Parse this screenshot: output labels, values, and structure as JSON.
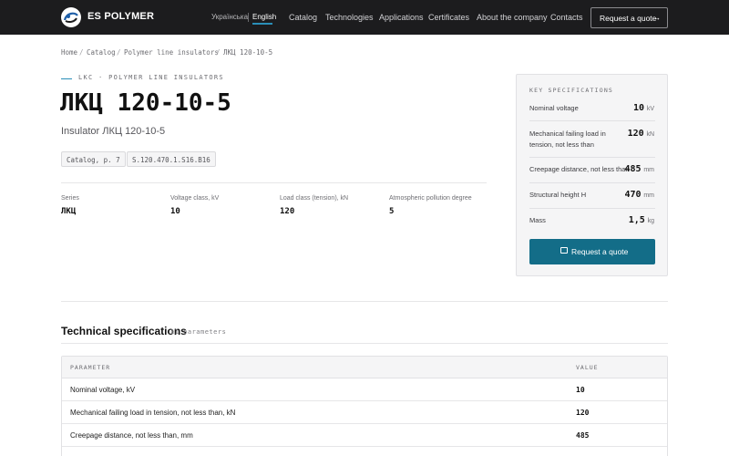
{
  "header": {
    "brand": "ES POLYMER",
    "lang_uk": "Українська",
    "lang_en": "English",
    "nav": [
      "Catalog",
      "Technologies",
      "Applications",
      "Certificates",
      "About the company",
      "Contacts"
    ],
    "quote_button": "Request a quote",
    "quote_arrow": "→"
  },
  "breadcrumb": [
    "Home",
    "Catalog",
    "Polymer line insulators",
    "ЛКЦ 120-10-5"
  ],
  "breadcrumb_sep": "/",
  "product": {
    "kicker": "LKC · POLYMER LINE INSULATORS",
    "title": "ЛКЦ 120-10-5",
    "subtitle": "Insulator ЛКЦ 120-10-5",
    "tags": [
      "Catalog, p. 7",
      "S.120.470.1.S16.B16"
    ],
    "stats": [
      {
        "label": "Series",
        "value": "ЛКЦ"
      },
      {
        "label": "Voltage class, kV",
        "value": "10"
      },
      {
        "label": "Load class (tension), kN",
        "value": "120"
      },
      {
        "label": "Atmospheric pollution degree",
        "value": "5"
      }
    ]
  },
  "key_specs": {
    "title": "KEY SPECIFICATIONS",
    "rows": [
      {
        "label": "Nominal voltage",
        "value": "10",
        "unit": "kV"
      },
      {
        "label": "Mechanical failing load in tension, not less than",
        "value": "120",
        "unit": "kN"
      },
      {
        "label": "Creepage distance, not less than",
        "value": "485",
        "unit": "mm"
      },
      {
        "label": "Structural height H",
        "value": "470",
        "unit": "mm"
      },
      {
        "label": "Mass",
        "value": "1,5",
        "unit": "kg"
      }
    ],
    "button": "Request a quote"
  },
  "tech": {
    "title": "Technical specifications",
    "count": "11 parameters",
    "col_param": "PARAMETER",
    "col_value": "VALUE",
    "rows": [
      {
        "param": "Nominal voltage, kV",
        "value": "10"
      },
      {
        "param": "Mechanical failing load in tension, not less than, kN",
        "value": "120"
      },
      {
        "param": "Creepage distance, not less than, mm",
        "value": "485"
      }
    ]
  },
  "colors": {
    "header_bg": "#1c1c1e",
    "accent": "#136d88",
    "accent_line": "#2a8fb8"
  }
}
